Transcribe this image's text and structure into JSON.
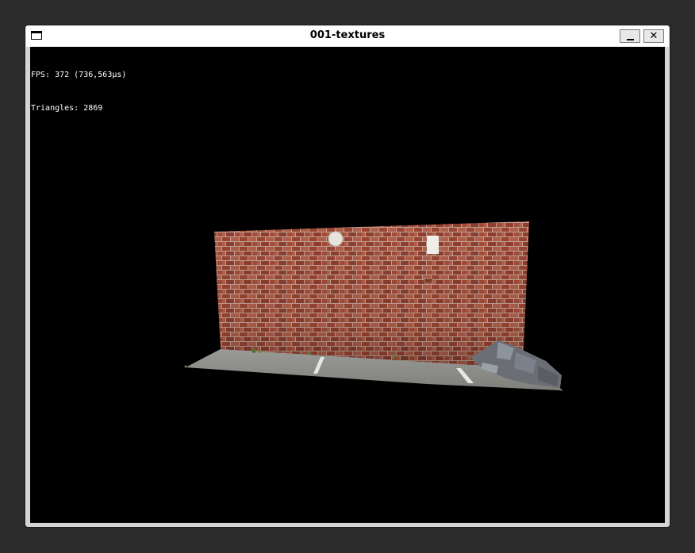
{
  "window": {
    "title": "001-textures",
    "minimize_label": "_",
    "close_label": "✕",
    "menu_icon": "window-menu-icon"
  },
  "overlay": {
    "fps_text": "FPS: 372 (736,563µs)",
    "triangles_text": "Triangles: 2869"
  },
  "scene": {
    "description_colors": {
      "background": "#000000",
      "brick": "#9a4a3a",
      "mortar": "#b8998a",
      "ground": "#8f8f8c"
    }
  }
}
